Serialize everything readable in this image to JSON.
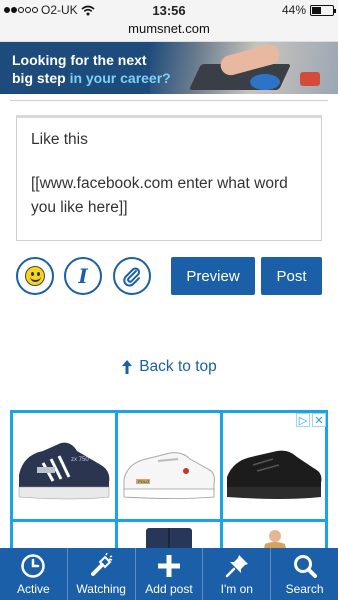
{
  "status": {
    "carrier": "O2-UK",
    "time": "13:56",
    "battery": "44%",
    "battery_level": 0.44
  },
  "url": "mumsnet.com",
  "banner": {
    "line1": "Looking for the next",
    "line2_prefix": "big step ",
    "line2_accent": "in your career?"
  },
  "post": {
    "line1": "Like this",
    "line2": "[[www.facebook.com enter what word you like here]]"
  },
  "toolbar": {
    "italic_glyph": "I",
    "preview_label": "Preview",
    "post_label": "Post"
  },
  "back_to_top": "Back to top",
  "ad": {
    "shoe1_tag": "zx 750",
    "shoe2_tag": "POLO"
  },
  "nav": {
    "items": [
      {
        "label": "Active",
        "icon": "clock-icon"
      },
      {
        "label": "Watching",
        "icon": "flashlight-icon"
      },
      {
        "label": "Add post",
        "icon": "plus-icon"
      },
      {
        "label": "I'm on",
        "icon": "pin-icon"
      },
      {
        "label": "Search",
        "icon": "search-icon"
      }
    ]
  },
  "colors": {
    "accent": "#1a5fa8",
    "ad_border": "#1aa3e6"
  }
}
